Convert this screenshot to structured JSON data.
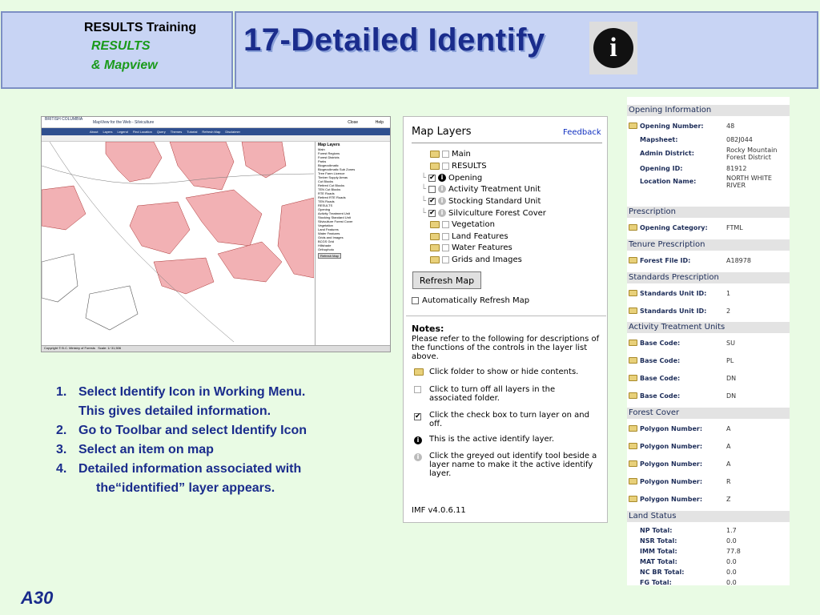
{
  "header": {
    "brand_line1": "RESULTS Training",
    "brand_line2": "RESULTS",
    "brand_line3": "& Mapview",
    "title": "17-Detailed Identify",
    "title_icon": "info-icon"
  },
  "mini_screenshot": {
    "logo": "BRITISH COLUMBIA",
    "app_title": "MapView for the Web - Silviculture",
    "close_label": "Close",
    "help_label": "Help",
    "nav_items": [
      "About",
      "Layers",
      "Legend",
      "Find Location",
      "Query",
      "Themes",
      "Tutorial",
      "Refresh Map",
      "Disclaimer"
    ],
    "layers_title": "Map Layers",
    "layers": [
      "Main",
      "Forest Regions",
      "Forest Districts",
      "Parks",
      "Biogeoclimatic",
      "Biogeoclimatic Sub Zones",
      "Tree Farm Licence",
      "Timber Supply Areas",
      "Cut Blocks",
      "Retired Cut Blocks",
      "TEN Cut Blocks",
      "RTE Roads",
      "Retired RTE Roads",
      "TEN Roads",
      "RESULTS",
      "Opening",
      "Activity Treatment Unit",
      "Stocking Standard Unit",
      "Silviculture Forest Cover",
      "Vegetation",
      "Land Features",
      "Water Features",
      "Grids and Images",
      "BCGS Grid",
      "Hillshade",
      "Orthophoto"
    ],
    "refresh_label": "Refresh Map",
    "copyright": "Copyright © B.C. Ministry of Forests",
    "scale": "Scale: 1/ 31,506"
  },
  "instructions": {
    "i1_num": "1.",
    "i1_a": "Select Identify Icon in Working Menu.",
    "i1_b": "This gives detailed information.",
    "i2_num": "2.",
    "i2": "Go to Toolbar and select Identify Icon",
    "i3_num": "3.",
    "i3": "Select an item on map",
    "i4_num": "4.",
    "i4_a": "Detailed information associated with",
    "i4_b": "the“identified” layer appears."
  },
  "map_layers": {
    "title": "Map Layers",
    "feedback": "Feedback",
    "items": {
      "main": "Main",
      "results": "RESULTS",
      "opening": "Opening",
      "atu": "Activity Treatment Unit",
      "ssu": "Stocking Standard Unit",
      "sfc": "Silviculture Forest Cover",
      "vegetation": "Vegetation",
      "land": "Land Features",
      "water": "Water Features",
      "grids": "Grids and Images"
    },
    "refresh_button": "Refresh Map",
    "auto_refresh": "Automatically Refresh Map",
    "notes_title": "Notes:",
    "notes_intro": "Please refer to the following for descriptions of the functions of the controls in the layer list above.",
    "note_folder": "Click folder to show or hide contents.",
    "note_greyed_box": "Click to turn off all layers in the associated folder.",
    "note_check": "Click the check box to turn layer on and off.",
    "note_active": "This is the active identify layer.",
    "note_greyed_identify": "Click the greyed out identify tool beside a layer name to make it the active identify layer.",
    "version": "IMF v4.0.6.11"
  },
  "info": {
    "opening_info": {
      "header": "Opening Information",
      "opening_number_label": "Opening Number:",
      "opening_number": "48",
      "mapsheet_label": "Mapsheet:",
      "mapsheet": "082J044",
      "admin_district_label": "Admin District:",
      "admin_district": "Rocky Mountain Forest District",
      "opening_id_label": "Opening ID:",
      "opening_id": "81912",
      "location_name_label": "Location Name:",
      "location_name": "NORTH WHITE RIVER"
    },
    "prescription": {
      "header": "Prescription",
      "label": "Opening Category:",
      "value": "FTML"
    },
    "tenure": {
      "header": "Tenure Prescription",
      "label": "Forest File ID:",
      "value": "A18978"
    },
    "standards": {
      "header": "Standards Prescription",
      "label": "Standards Unit ID:",
      "v1": "1",
      "v2": "2"
    },
    "atu": {
      "header": "Activity Treatment Units",
      "label": "Base Code:",
      "v1": "SU",
      "v2": "PL",
      "v3": "DN",
      "v4": "DN"
    },
    "forest_cover": {
      "header": "Forest Cover",
      "label": "Polygon Number:",
      "v1": "A",
      "v2": "A",
      "v3": "A",
      "v4": "R",
      "v5": "Z"
    },
    "land_status": {
      "header": "Land Status",
      "np_label": "NP Total:",
      "np": "1.7",
      "nsr_label": "NSR Total:",
      "nsr": "0.0",
      "imm_label": "IMM Total:",
      "imm": "77.8",
      "mat_label": "MAT Total:",
      "mat": "0.0",
      "ncbr_label": "NC BR Total:",
      "ncbr": "0.0",
      "fg_label": "FG Total:",
      "fg": "0.0"
    }
  },
  "slide_number": "A30",
  "colors": {
    "title": "#1a2c8c",
    "brand_green": "#1a9a1a",
    "header_bg": "#c8d4f4",
    "page_bg": "#e9fbe4",
    "polygon": "#f2b1b4"
  }
}
